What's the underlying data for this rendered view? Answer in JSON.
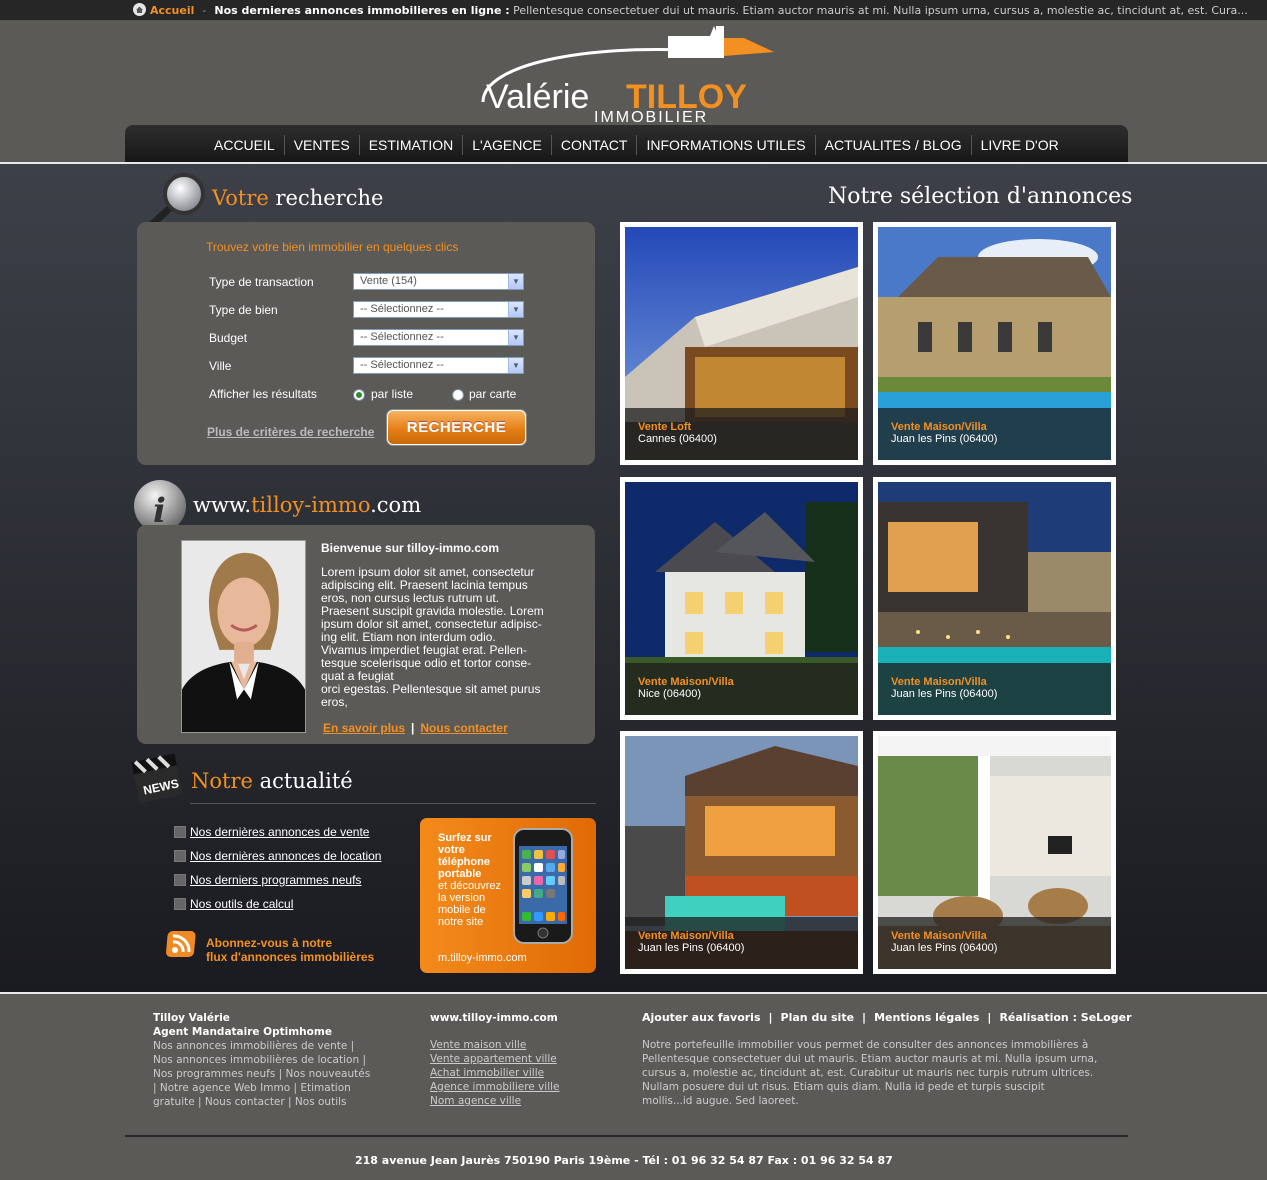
{
  "ticker": {
    "home_label": "Accueil",
    "separator": "-",
    "title": "Nos dernieres annonces immobilieres en ligne :",
    "text": "Pellentesque consectetuer dui ut mauris. Etiam auctor mauris at mi. Nulla ipsum urna, cursus a, molestie ac, tincidunt at, est. Cura..."
  },
  "logo": {
    "first": "Valérie",
    "last": "TILLOY",
    "sub": "IMMOBILIER"
  },
  "nav": [
    "ACCUEIL",
    "VENTES",
    "ESTIMATION",
    "L'AGENCE",
    "CONTACT",
    "INFORMATIONS UTILES",
    "ACTUALITES / BLOG",
    "LIVRE D'OR"
  ],
  "search": {
    "title_accent": "Votre",
    "title_rest": "recherche",
    "heading": "Trouvez votre bien immobilier en quelques clics",
    "fields": [
      {
        "label": "Type de transaction",
        "value": "Vente (154)"
      },
      {
        "label": "Type de bien",
        "value": "-- Sélectionnez --"
      },
      {
        "label": "Budget",
        "value": "-- Sélectionnez --"
      },
      {
        "label": "Ville",
        "value": "-- Sélectionnez --"
      }
    ],
    "results_label": "Afficher les résultats",
    "radio_list": "par liste",
    "radio_map": "par carte",
    "more_link": "Plus de critères de recherche",
    "button": "RECHERCHE"
  },
  "info": {
    "site_pre": "www.",
    "site_accent": "tilloy-immo",
    "site_post": ".com",
    "welcome_title": "Bienvenue sur tilloy-immo.com",
    "welcome_lines": [
      "Lorem ipsum dolor sit amet, consectetur",
      "adipiscing elit. Praesent lacinia tempus",
      "eros, non cursus lectus rutrum ut.",
      "Praesent suscipit gravida molestie. Lorem",
      "ipsum dolor sit amet, consectetur adipisc-",
      "ing elit. Etiam non interdum odio.",
      "Vivamus imperdiet feugiat erat. Pellen-",
      "tesque scelerisque odio et tortor conse-",
      "quat a feugiat",
      "orci egestas. Pellentesque sit amet purus",
      "eros,"
    ],
    "link_more": "En savoir plus",
    "link_sep": "|",
    "link_contact": "Nous contacter"
  },
  "news": {
    "title_accent": "Notre",
    "title_rest": "actualité",
    "badge": "NEWS",
    "items": [
      "Nos dernières annonces de vente",
      "Nos dernières annonces de location",
      "Nos derniers programmes neufs",
      "Nos outils de calcul"
    ],
    "rss_line1": "Abonnez-vous à notre",
    "rss_line2": "flux d'annonces immobilières"
  },
  "mobile": {
    "title_lines": [
      "Surfez sur",
      "votre",
      "téléphone",
      "portable"
    ],
    "sub_lines": [
      "et découvrez",
      "la version",
      "mobile de",
      "notre site"
    ],
    "url": "m.tilloy-immo.com"
  },
  "listings": {
    "title": "Notre sélection d'annonces",
    "cards": [
      {
        "type": "Vente Loft",
        "location": "Cannes (06400)"
      },
      {
        "type": "Vente Maison/Villa",
        "location": "Juan les Pins (06400)"
      },
      {
        "type": "Vente Maison/Villa",
        "location": "Nice (06400)"
      },
      {
        "type": "Vente Maison/Villa",
        "location": "Juan les Pins (06400)"
      },
      {
        "type": "Vente Maison/Villa",
        "location": "Juan les Pins (06400)"
      },
      {
        "type": "Vente Maison/Villa",
        "location": "Juan les Pins (06400)"
      }
    ]
  },
  "footer": {
    "name": "Tilloy Valérie",
    "role": "Agent Mandataire Optimhome",
    "col1_lines": [
      "Nos annonces immobilières de vente |",
      "Nos annonces immobilières de location |",
      "Nos programmes neufs | Nos nouveautés",
      "| Notre agence Web Immo | Etimation",
      "gratuite | Nous contacter | Nos outils"
    ],
    "site": "www.tilloy-immo.com",
    "col2_links": [
      "Vente maison ville",
      "Vente appartement ville",
      "Achat immobilier ville",
      "Agence immobiliere ville",
      "Nom agence ville"
    ],
    "top_links": [
      "Ajouter aux favoris",
      "Plan du site",
      "Mentions légales",
      "Réalisation : SeLoger"
    ],
    "pipe": "|",
    "description": "Notre portefeuille immobilier vous permet de consulter des annonces immobilières à Pellentesque consectetuer dui ut mauris. Etiam auctor mauris at mi. Nulla ipsum urna, cursus a, molestie ac, tincidunt at, est. Curabitur ut mauris nec turpis rutrum ultrices. Nullam posuere dui ut risus. Etiam quis diam. Nulla id pede et turpis suscipit mollis...id augue. Sed laoreet.",
    "address": "218 avenue Jean Jaurès 750190 Paris 19ème -  Tél : 01 96 32 54 87  Fax : 01 96 32 54 87"
  },
  "colors": {
    "accent": "#f39022",
    "panel": "#5c5a56",
    "dark": "#1a1b20"
  }
}
